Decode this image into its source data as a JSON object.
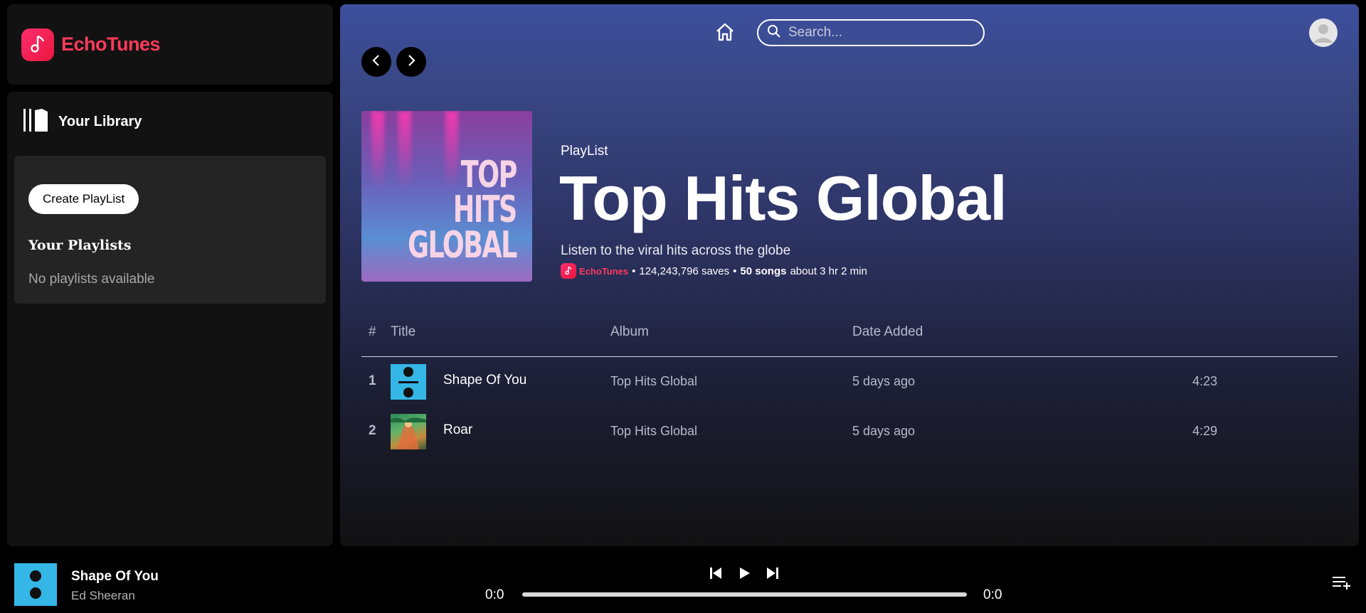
{
  "brand": {
    "name": "EchoTunes",
    "logo_icon": "music-note-icon",
    "color": "#ff3a5c"
  },
  "sidebar": {
    "library_title": "Your Library",
    "library_icon": "library-icon",
    "create_playlist_label": "Create PlayList",
    "playlists_heading": "Your Playlists",
    "empty_message": "No playlists available"
  },
  "header": {
    "search_placeholder": "Search...",
    "home_icon": "home-icon",
    "avatar_icon": "user-avatar-icon"
  },
  "playlist": {
    "type_label": "PlayList",
    "title": "Top Hits Global",
    "cover_text": [
      "TOP",
      "HITS",
      "GLOBAL"
    ],
    "description": "Listen to the viral hits across the globe",
    "meta_brand": "EchoTunes",
    "saves": "124,243,796 saves",
    "separator": "•",
    "songs_count": "50 songs",
    "duration": "about 3 hr 2 min"
  },
  "table": {
    "headers": {
      "num": "#",
      "title": "Title",
      "album": "Album",
      "date": "Date Added"
    },
    "rows": [
      {
        "num": "1",
        "title": "Shape Of You",
        "album": "Top Hits Global",
        "date": "5 days ago",
        "duration": "4:23",
        "cover": "divide-album-cover"
      },
      {
        "num": "2",
        "title": "Roar",
        "album": "Top Hits Global",
        "date": "5 days ago",
        "duration": "4:29",
        "cover": "prism-album-cover"
      }
    ]
  },
  "player": {
    "title": "Shape Of You",
    "artist": "Ed Sheeran",
    "current_time": "0:0",
    "total_time": "0:0",
    "progress": 0,
    "controls": [
      "previous-icon",
      "play-icon",
      "next-icon"
    ],
    "queue_icon": "queue-icon"
  },
  "colors": {
    "accent": "#ff3a5c",
    "main_gradient_top": "#3d4f9e",
    "main_gradient_bottom": "#121212",
    "panel": "#121212"
  }
}
